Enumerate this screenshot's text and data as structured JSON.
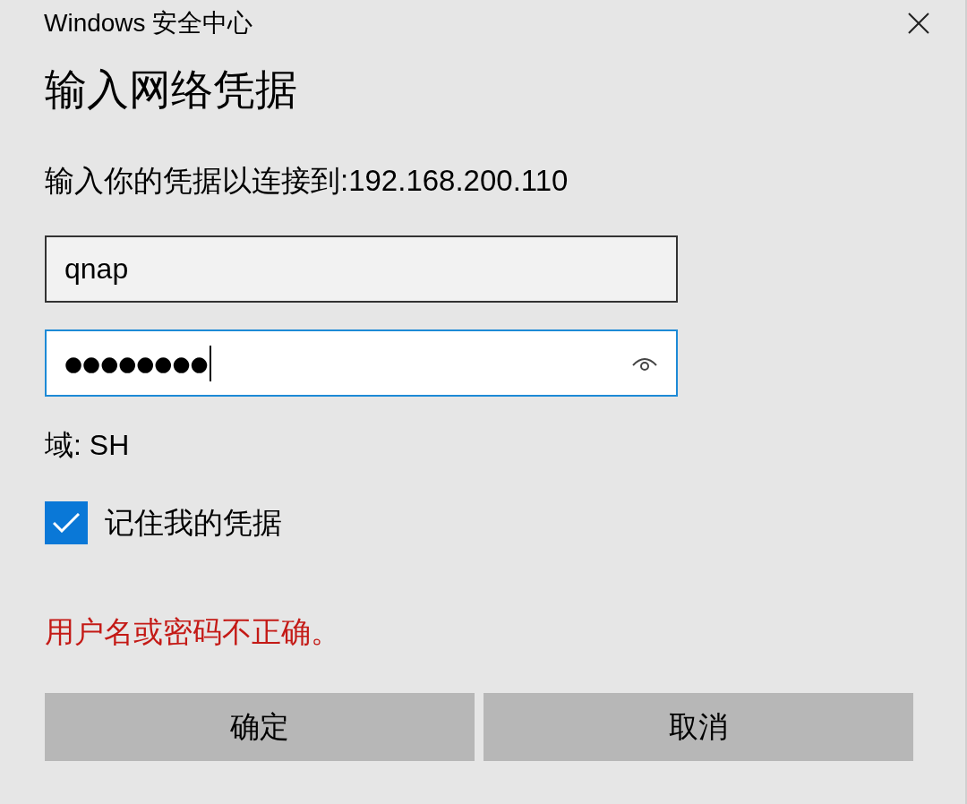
{
  "window": {
    "title": "Windows 安全中心"
  },
  "heading": "输入网络凭据",
  "prompt": "输入你的凭据以连接到:192.168.200.110",
  "fields": [
    {
      "kind": "text",
      "value": "qnap",
      "focused": false
    },
    {
      "kind": "password",
      "value": "●●●●●●●●",
      "focused": true
    }
  ],
  "domain": "域: SH",
  "remember": {
    "label": "记住我的凭据",
    "checked": true
  },
  "error": "用户名或密码不正确。",
  "buttons": [
    {
      "label": "确定"
    },
    {
      "label": "取消"
    }
  ]
}
